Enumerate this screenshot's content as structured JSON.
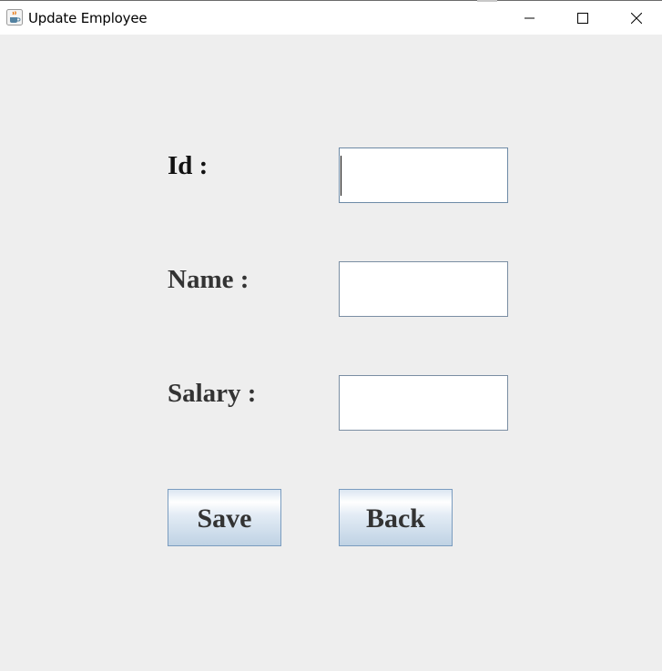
{
  "window": {
    "title": "Update Employee",
    "icon": "java-cup-icon",
    "controls": {
      "minimize": "minimize-icon",
      "maximize": "maximize-icon",
      "close": "close-icon"
    }
  },
  "form": {
    "id_label": "Id :",
    "name_label": "Name :",
    "salary_label": "Salary :",
    "id_value": "",
    "name_value": "",
    "salary_value": ""
  },
  "buttons": {
    "save_label": "Save",
    "back_label": "Back"
  },
  "colors": {
    "background": "#eeeeee",
    "label_text": "#333333",
    "button_border": "#7a9cbf",
    "field_border": "#7a8ea3"
  }
}
